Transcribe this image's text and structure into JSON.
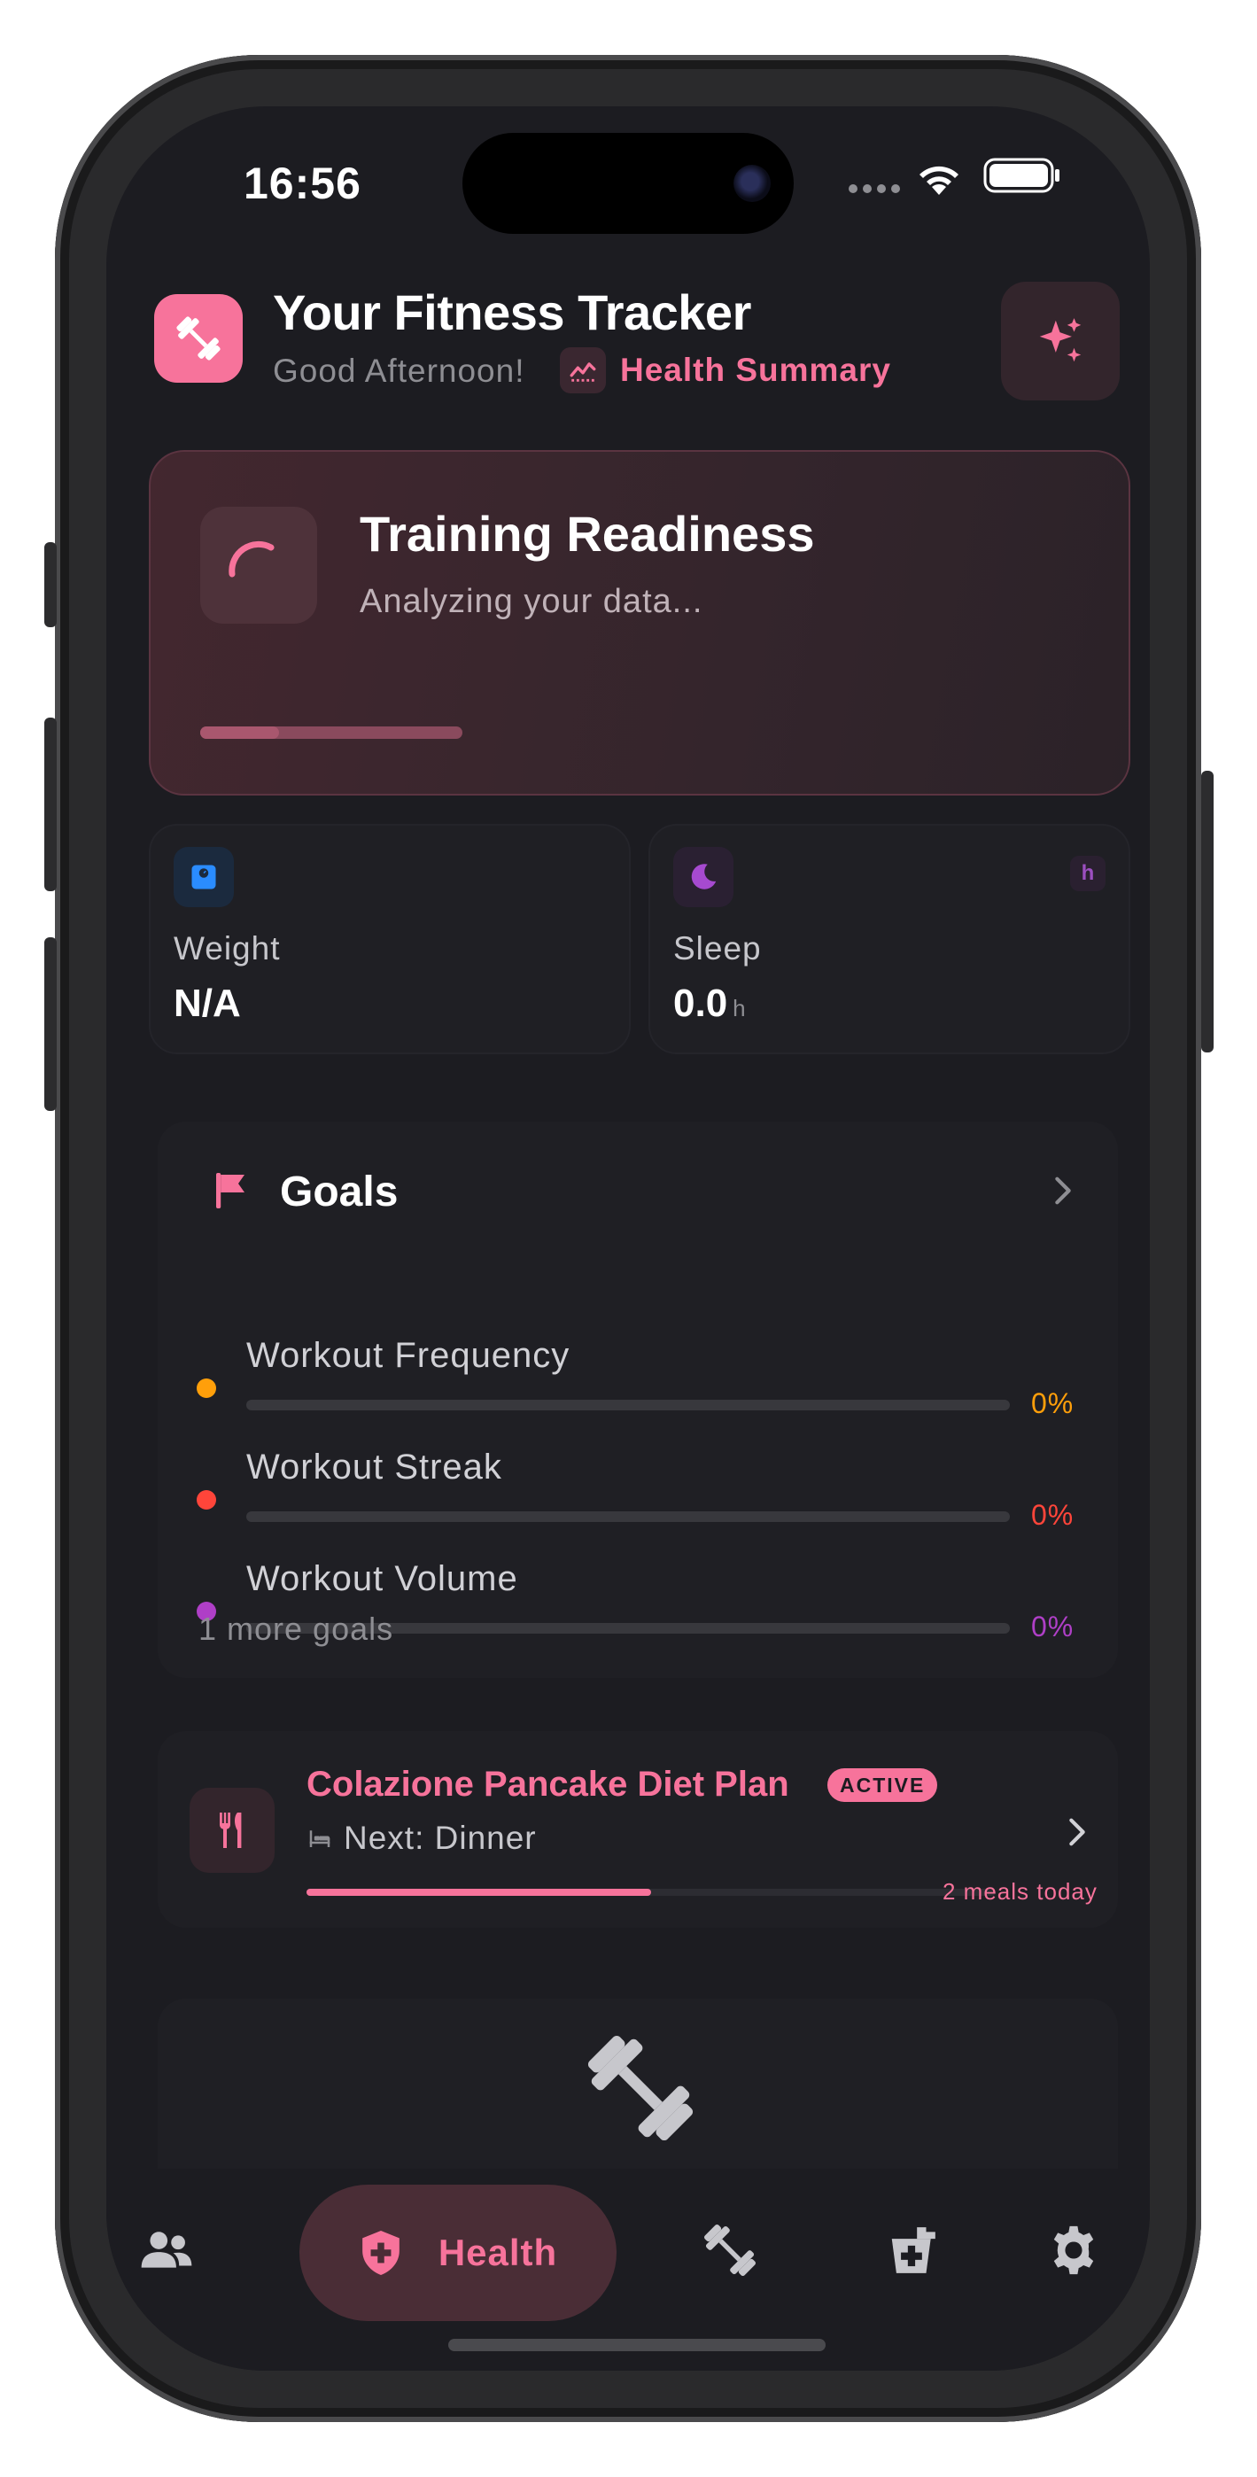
{
  "status_bar": {
    "time": "16:56"
  },
  "header": {
    "title": "Your Fitness Tracker",
    "greeting": "Good Afternoon!",
    "health_summary": "Health Summary"
  },
  "readiness": {
    "title": "Training Readiness",
    "subtitle": "Analyzing your data...",
    "progress": 0.3
  },
  "metrics": {
    "weight": {
      "label": "Weight",
      "value": "N/A"
    },
    "sleep": {
      "label": "Sleep",
      "value": "0.0",
      "unit": "h",
      "badge": "h"
    }
  },
  "goals": {
    "title": "Goals",
    "items": [
      {
        "name": "Workout Frequency",
        "percent": "0%",
        "color": "#ff9f0a"
      },
      {
        "name": "Workout Streak",
        "percent": "0%",
        "color": "#ff453a"
      },
      {
        "name": "Workout Volume",
        "percent": "0%",
        "color": "#af3fc7"
      }
    ],
    "more": "1 more goals"
  },
  "diet_plan": {
    "title": "Colazione Pancake Diet Plan",
    "badge": "ACTIVE",
    "next": "Next: Dinner",
    "meals": "2 meals today",
    "progress": 0.5
  },
  "tab_bar": {
    "active_label": "Health",
    "tabs": [
      "people-icon",
      "health-shield-icon",
      "dumbbell-icon",
      "medicine-icon",
      "gear-icon"
    ]
  },
  "colors": {
    "accent": "#f7739b",
    "background": "#1c1c21",
    "card": "#1f1f24"
  }
}
